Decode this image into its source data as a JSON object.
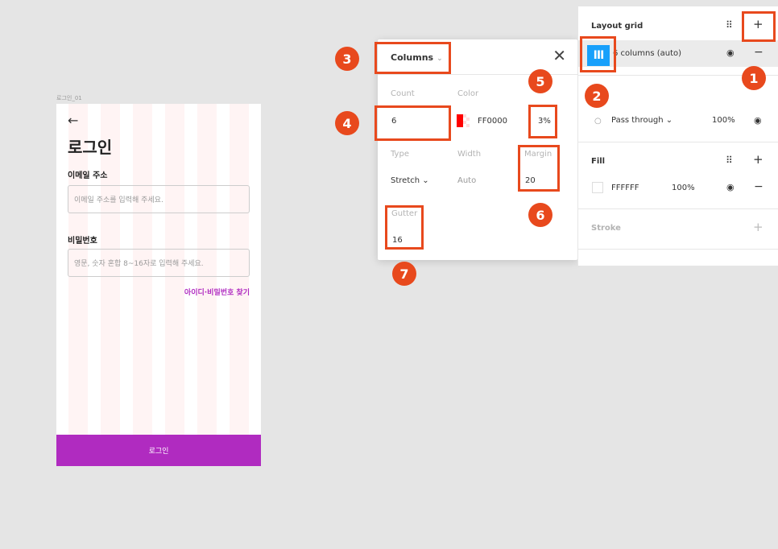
{
  "frame": {
    "label": "로그인_01",
    "back_icon": "←",
    "title": "로그인",
    "email_label": "이메일 주소",
    "email_placeholder": "이메일 주소를 입력해 주세요.",
    "password_label": "비밀번호",
    "password_placeholder": "영문, 숫자 혼합 8~16자로 입력해 주세요.",
    "find_link": "아이디·비밀번호 찾기",
    "login_button": "로그인",
    "column_count": 6,
    "accent_color": "#b02bc0"
  },
  "grid_popup": {
    "type": "Columns",
    "type_chevron": "⌄",
    "close_icon": "✕",
    "count_label": "Count",
    "count_value": "6",
    "color_label": "Color",
    "color_hex": "FF0000",
    "color_opacity": "3%",
    "type_label": "Type",
    "type_value": "Stretch ⌄",
    "width_label": "Width",
    "width_value": "Auto",
    "margin_label": "Margin",
    "margin_value": "20",
    "gutter_label": "Gutter",
    "gutter_value": "16"
  },
  "panel": {
    "layout_grid_title": "Layout grid",
    "layout_grid_item": "6 columns (auto)",
    "grid_icon": "III",
    "blend_mode": "Pass through ⌄",
    "layer_opacity": "100%",
    "fill_title": "Fill",
    "fill_hex": "FFFFFF",
    "fill_opacity": "100%",
    "stroke_title": "Stroke",
    "dots_icon": "⠿",
    "plus_icon": "+",
    "minus_icon": "−",
    "eye_icon": "◉",
    "drop_icon": "○"
  },
  "annotations": [
    "1",
    "2",
    "3",
    "4",
    "5",
    "6",
    "7"
  ],
  "colors": {
    "annotation": "#e8491d",
    "selection_blue": "#18a0fb",
    "grid_red": "#ff0000"
  }
}
